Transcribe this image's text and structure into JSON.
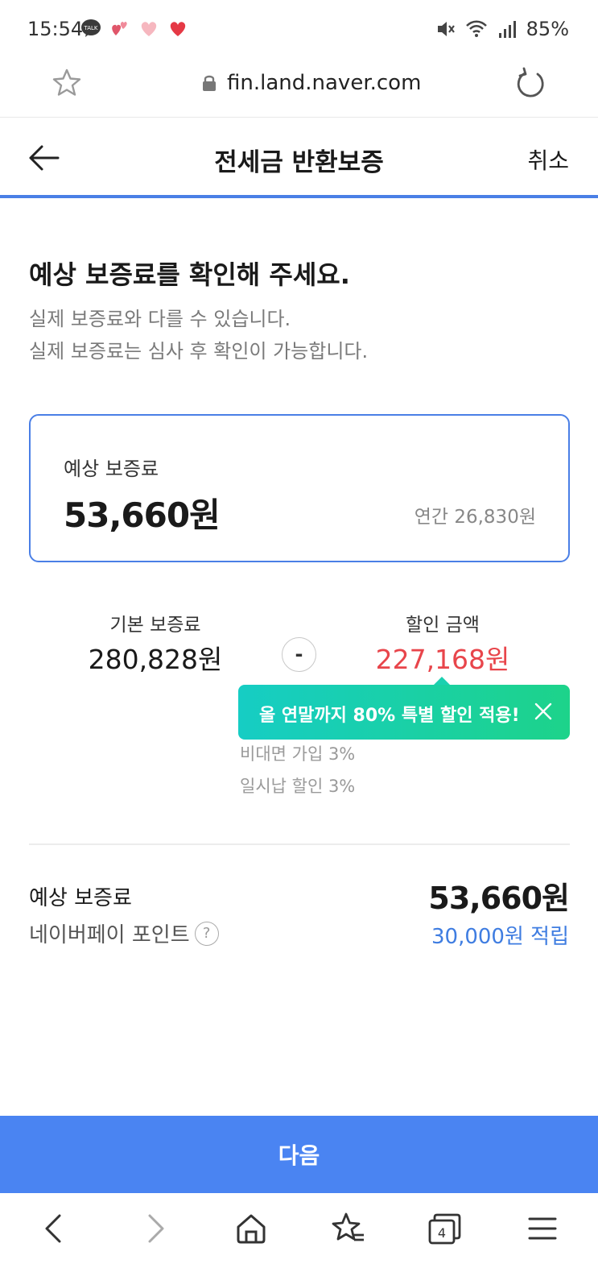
{
  "status_bar": {
    "time": "15:54",
    "battery": "85%",
    "notif_badge": "TALK"
  },
  "browser": {
    "url": "fin.land.naver.com",
    "tabs_count": "4"
  },
  "header": {
    "title": "전세금 반환보증",
    "cancel_label": "취소"
  },
  "intro": {
    "heading": "예상 보증료를 확인해 주세요.",
    "line1": "실제 보증료와 다를 수 있습니다.",
    "line2": "실제 보증료는 심사 후 확인이 가능합니다."
  },
  "summary_card": {
    "label": "예상 보증료",
    "amount": "53,660원",
    "annual": "연간 26,830원"
  },
  "breakdown": {
    "base_label": "기본 보증료",
    "base_value": "280,828원",
    "operator": "-",
    "discount_label": "할인 금액",
    "discount_value": "227,168원",
    "tooltip": "올 연말까지 80% 특별 할인 적용!",
    "details": [
      "비대면 가입 3%",
      "일시납 할인 3%"
    ]
  },
  "totals": {
    "expected_label": "예상 보증료",
    "expected_value": "53,660원",
    "points_label": "네이버페이 포인트",
    "points_help": "?",
    "points_value": "30,000원 적립"
  },
  "footer": {
    "next_label": "다음"
  },
  "colors": {
    "accent": "#4a84f2",
    "discount": "#e8454b",
    "points": "#3f7de1",
    "tooltip_start": "#16cdc4",
    "tooltip_end": "#1dd38a"
  }
}
